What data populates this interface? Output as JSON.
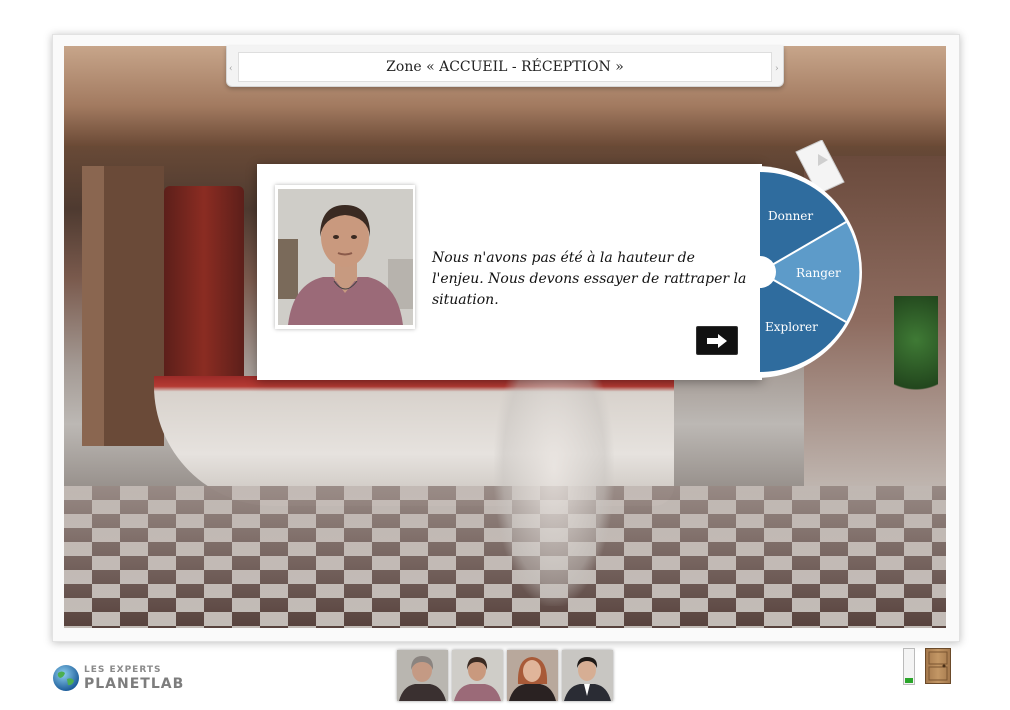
{
  "zone": {
    "title": "Zone « ACCUEIL - RÉCEPTION »"
  },
  "dialog": {
    "text": "Nous n'avons pas été à la hauteur de l'enjeu. Nous devons essayer de rattraper la situation.",
    "next_icon": "arrow-right-icon"
  },
  "wheel": {
    "items": [
      {
        "label": "Donner"
      },
      {
        "label": "Ranger"
      },
      {
        "label": "Explorer"
      }
    ],
    "colors": {
      "dark": "#2c6a9c",
      "light": "#5a9ac8",
      "rim": "#ffffff"
    }
  },
  "footer": {
    "logo_line1": "LES EXPERTS",
    "logo_line2": "PLANETLAB",
    "characters": [
      {
        "icon": "character-1-portrait"
      },
      {
        "icon": "character-2-portrait"
      },
      {
        "icon": "character-3-portrait"
      },
      {
        "icon": "character-4-portrait"
      }
    ],
    "gauge_level": 0.15,
    "exit_icon": "door-icon"
  }
}
